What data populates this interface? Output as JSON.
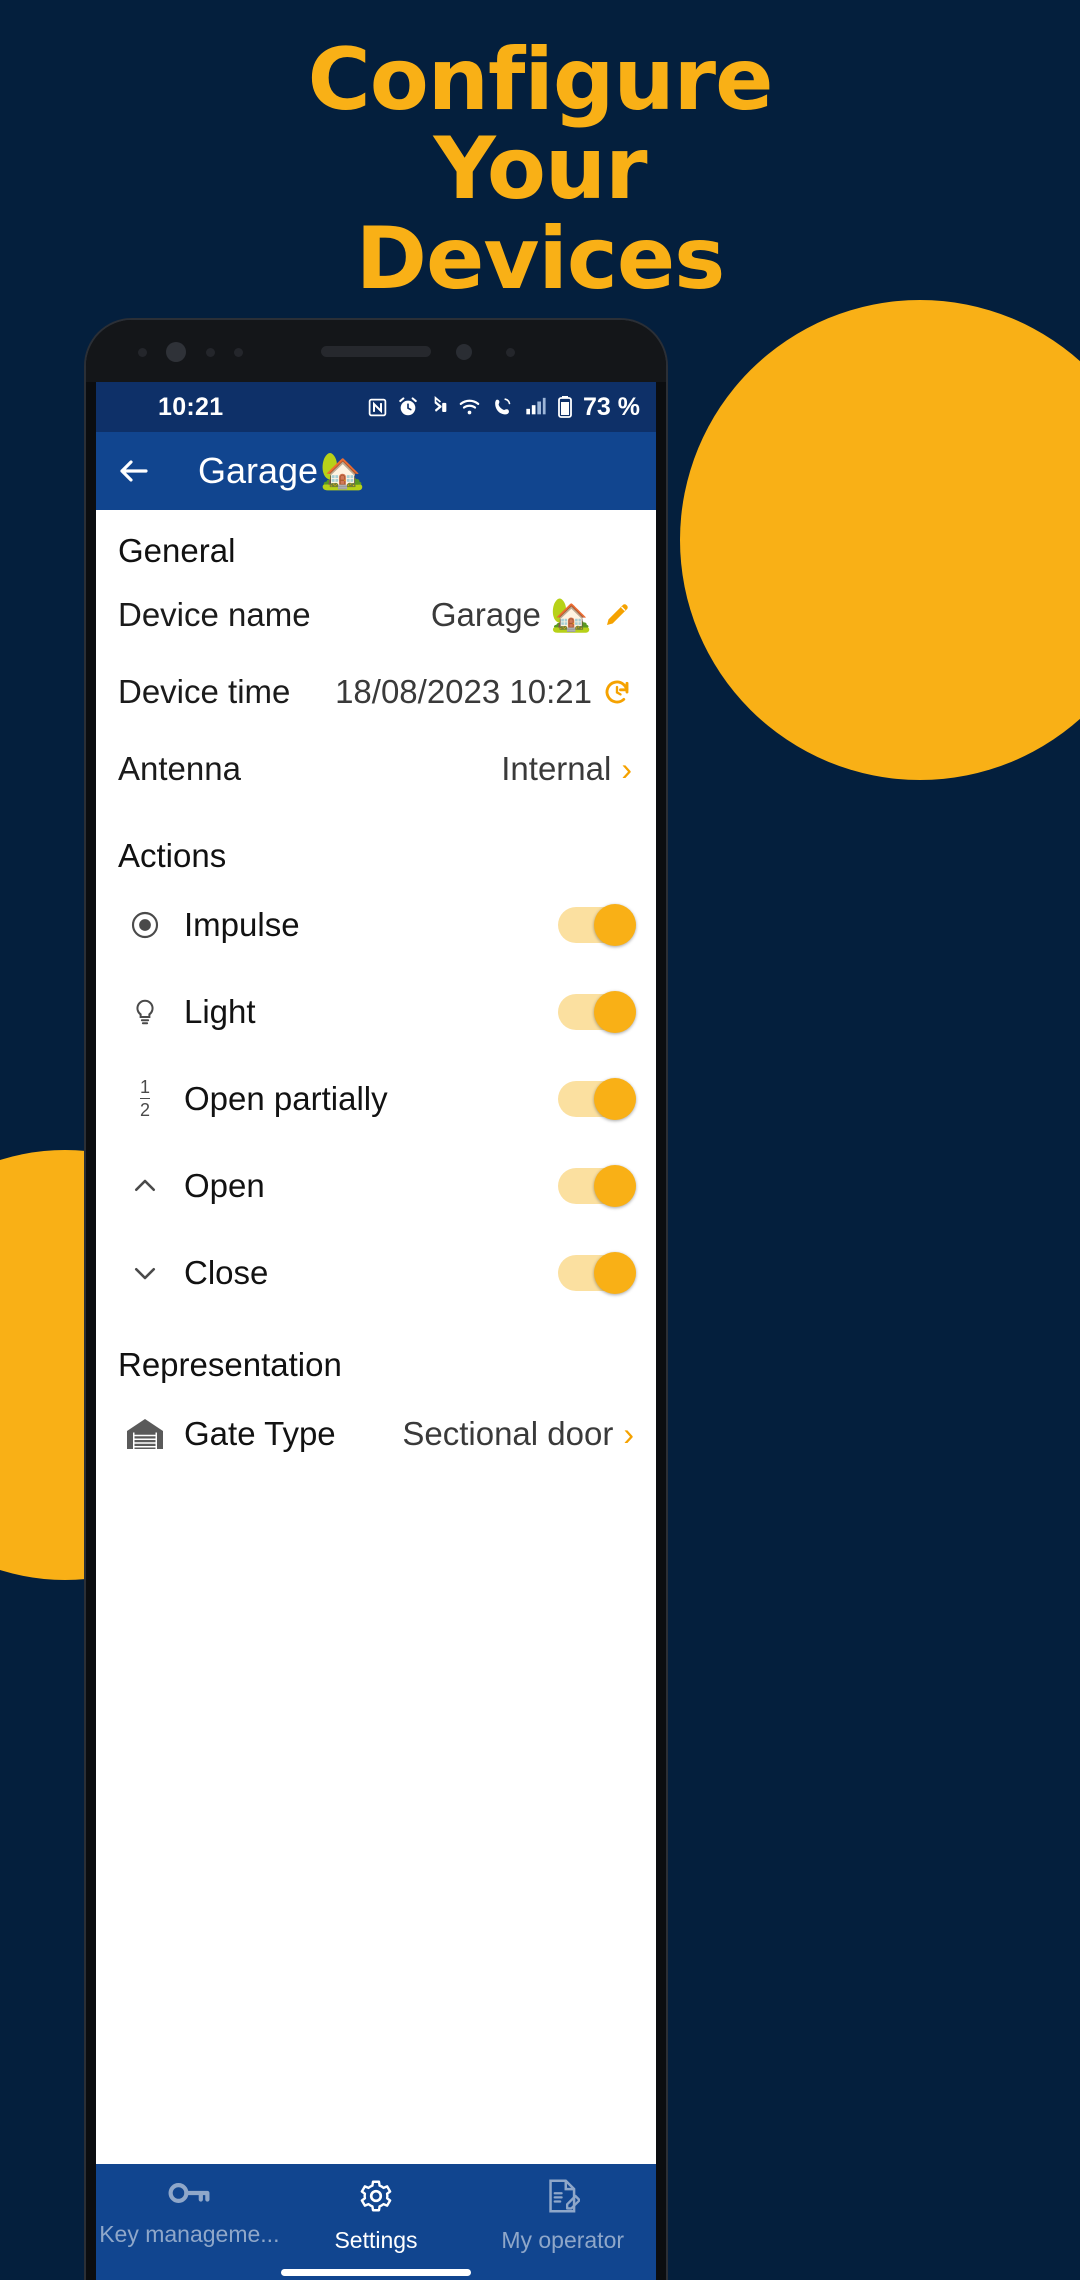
{
  "promo": {
    "line1": "Configure",
    "line2": "Your",
    "line3": "Devices",
    "accent_color": "#F9B016",
    "background_color": "#041F3D"
  },
  "status_bar": {
    "time": "10:21",
    "battery_percent": "73 %",
    "icons": [
      "nfc-icon",
      "alarm-icon",
      "bluetooth-icon",
      "wifi-icon",
      "call-icon",
      "signal-icon",
      "battery-icon"
    ]
  },
  "app_bar": {
    "back_icon": "back-arrow-icon",
    "title": "Garage",
    "title_emoji": "🏡"
  },
  "sections": {
    "general": {
      "heading": "General",
      "rows": [
        {
          "label": "Device name",
          "value": "Garage",
          "emoji": "🏡",
          "trailing_icon": "pencil-icon"
        },
        {
          "label": "Device time",
          "value": "18/08/2023 10:21",
          "emoji": "",
          "trailing_icon": "refresh-clock-icon"
        },
        {
          "label": "Antenna",
          "value": "Internal",
          "emoji": "",
          "trailing_icon": "chevron-right-icon"
        }
      ]
    },
    "actions": {
      "heading": "Actions",
      "rows": [
        {
          "label": "Impulse",
          "icon": "radio-dot-icon",
          "enabled": true
        },
        {
          "label": "Light",
          "icon": "lightbulb-icon",
          "enabled": true
        },
        {
          "label": "Open partially",
          "icon": "one-half-fraction-icon",
          "enabled": true
        },
        {
          "label": "Open",
          "icon": "chevron-up-icon",
          "enabled": true
        },
        {
          "label": "Close",
          "icon": "chevron-down-icon",
          "enabled": true
        }
      ]
    },
    "representation": {
      "heading": "Representation",
      "rows": [
        {
          "label": "Gate Type",
          "icon": "garage-door-icon",
          "value": "Sectional door",
          "trailing_icon": "chevron-right-icon"
        }
      ]
    }
  },
  "bottom_nav": {
    "items": [
      {
        "label": "Key manageme...",
        "icon": "key-icon",
        "active": false
      },
      {
        "label": "Settings",
        "icon": "gear-icon",
        "active": true
      },
      {
        "label": "My operator",
        "icon": "document-edit-icon",
        "active": false
      }
    ]
  }
}
